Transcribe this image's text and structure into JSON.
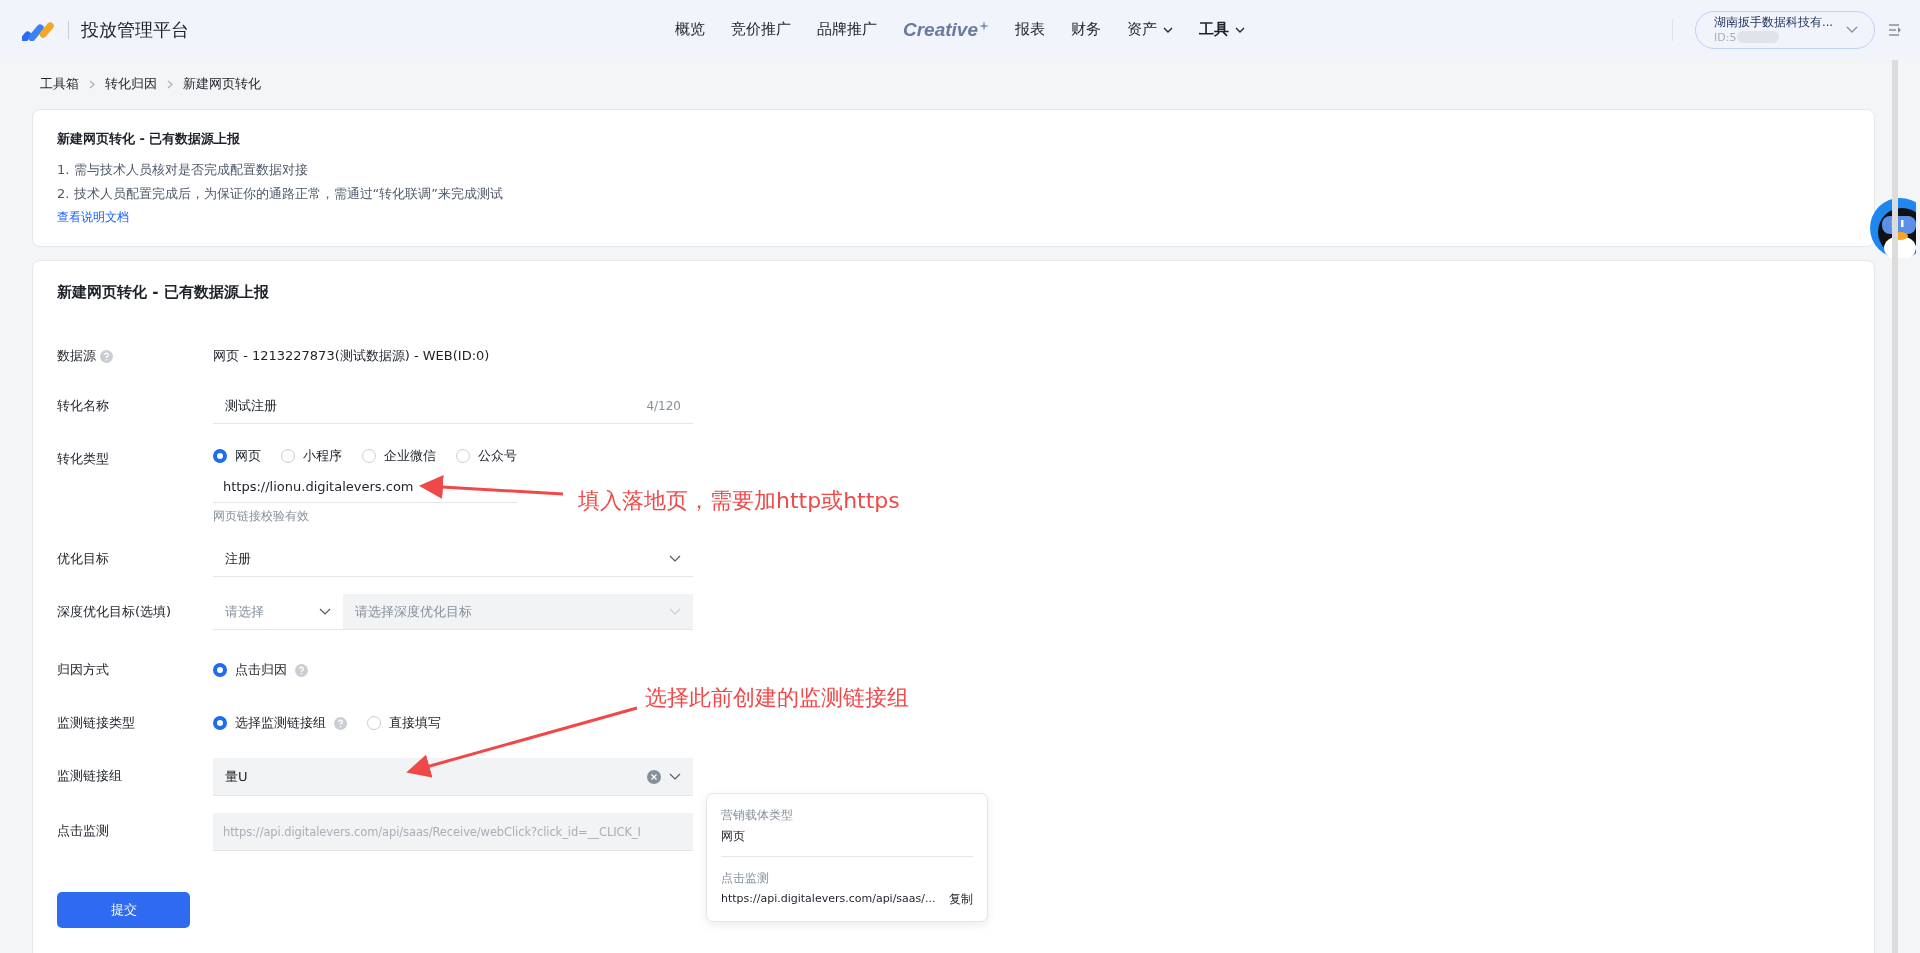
{
  "header": {
    "logo_text": "投放管理平台",
    "nav": [
      {
        "label": "概览",
        "selected": false,
        "caret": false,
        "kind": "text"
      },
      {
        "label": "竞价推广",
        "selected": false,
        "caret": false,
        "kind": "text"
      },
      {
        "label": "品牌推广",
        "selected": false,
        "caret": false,
        "kind": "text"
      },
      {
        "label": "Creative",
        "selected": false,
        "caret": false,
        "kind": "brand"
      },
      {
        "label": "报表",
        "selected": false,
        "caret": false,
        "kind": "text"
      },
      {
        "label": "财务",
        "selected": false,
        "caret": false,
        "kind": "text"
      },
      {
        "label": "资产",
        "selected": false,
        "caret": true,
        "kind": "text"
      },
      {
        "label": "工具",
        "selected": true,
        "caret": true,
        "kind": "text"
      }
    ],
    "account": {
      "name": "湖南扳手数据科技有...",
      "id": "ID:5"
    }
  },
  "breadcrumb": [
    "工具箱",
    "转化归因",
    "新建网页转化"
  ],
  "notice": {
    "title": "新建网页转化 - 已有数据源上报",
    "lines": [
      "1. 需与技术人员核对是否完成配置数据对接",
      "2. 技术人员配置完成后，为保证你的通路正常，需通过“转化联调”来完成测试"
    ],
    "link": "查看说明文档"
  },
  "form": {
    "title": "新建网页转化 - 已有数据源上报",
    "rows": [
      {
        "kind": "text",
        "label": "数据源",
        "help": true,
        "value": "网页 - 1213227873(测试数据源) - WEB(ID:0)"
      },
      {
        "kind": "input",
        "label": "转化名称",
        "value": "测试注册",
        "counter": "4/120"
      },
      {
        "kind": "radio",
        "label": "转化类型",
        "options": [
          {
            "label": "网页",
            "selected": true,
            "help": false
          },
          {
            "label": "小程序",
            "selected": false,
            "help": false
          },
          {
            "label": "企业微信",
            "selected": false,
            "help": false
          },
          {
            "label": "公众号",
            "selected": false,
            "help": false
          }
        ],
        "url": "https://lionu.digitalevers.com",
        "hint": "网页链接校验有效"
      },
      {
        "kind": "select",
        "label": "优化目标",
        "value": "注册",
        "filled": false,
        "clearable": false
      },
      {
        "kind": "dual_select",
        "label": "深度优化目标(选填)",
        "placeholder": "请选择",
        "placeholder_2": "请选择深度优化目标"
      },
      {
        "kind": "radio",
        "label": "归因方式",
        "options": [
          {
            "label": "点击归因",
            "selected": true,
            "help": true
          }
        ]
      },
      {
        "kind": "radio",
        "label": "监测链接类型",
        "options": [
          {
            "label": "选择监测链接组",
            "selected": true,
            "help": true
          },
          {
            "label": "直接填写",
            "selected": false,
            "help": false
          }
        ]
      },
      {
        "kind": "select",
        "label": "监测链接组",
        "value": "量U",
        "filled": true,
        "clearable": true
      },
      {
        "kind": "readonly",
        "label": "点击监测",
        "value": "https://api.digitalevers.com/api/saas/Receive/webClick?click_id=__CLICK_I"
      }
    ],
    "submit": "提交"
  },
  "popover": {
    "type_label": "营销载体类型",
    "type_value": "网页",
    "click_label": "点击监测",
    "click_value": "https://api.digitalevers.com/api/saas/...",
    "copy": "复制"
  },
  "annotations": [
    "填入落地页，需要加http或https",
    "选择此前创建的监测链接组"
  ]
}
